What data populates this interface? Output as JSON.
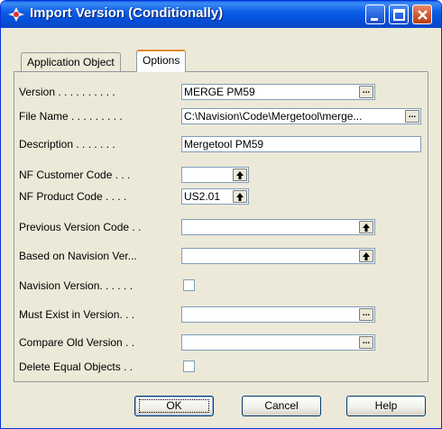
{
  "window": {
    "title": "Import Version (Conditionally)"
  },
  "tabs": [
    {
      "label": "Application Object",
      "active": false
    },
    {
      "label": "Options",
      "active": true
    }
  ],
  "fields": {
    "version": {
      "label": "Version . . . . . . . . . .",
      "value": "MERGE PM59"
    },
    "file_name": {
      "label": "File Name . . . . . . . . .",
      "value": "C:\\Navision\\Code\\Mergetool\\merge..."
    },
    "description": {
      "label": "Description . . . . . . .",
      "value": "Mergetool PM59"
    },
    "nf_customer_code": {
      "label": "NF Customer Code . . .",
      "value": ""
    },
    "nf_product_code": {
      "label": "NF Product Code . . . .",
      "value": "US2.01"
    },
    "previous_version_code": {
      "label": "Previous Version Code . .",
      "value": ""
    },
    "based_on_navision_version": {
      "label": "Based on Navision Ver...",
      "value": ""
    },
    "navision_version": {
      "label": "Navision Version. . . . . .",
      "checked": false
    },
    "must_exist_in_version": {
      "label": "Must Exist in Version. . .",
      "value": ""
    },
    "compare_old_version": {
      "label": "Compare Old Version . .",
      "value": ""
    },
    "delete_equal_objects": {
      "label": "Delete Equal Objects . .",
      "checked": false
    }
  },
  "buttons": {
    "ok": "OK",
    "cancel": "Cancel",
    "help": "Help",
    "ellipsis": "...",
    "lookup_arrow": "🠉"
  },
  "colors": {
    "titlebar": "#0a5fe6",
    "dialog_bg": "#ece9d8",
    "field_border": "#7f9db9"
  }
}
